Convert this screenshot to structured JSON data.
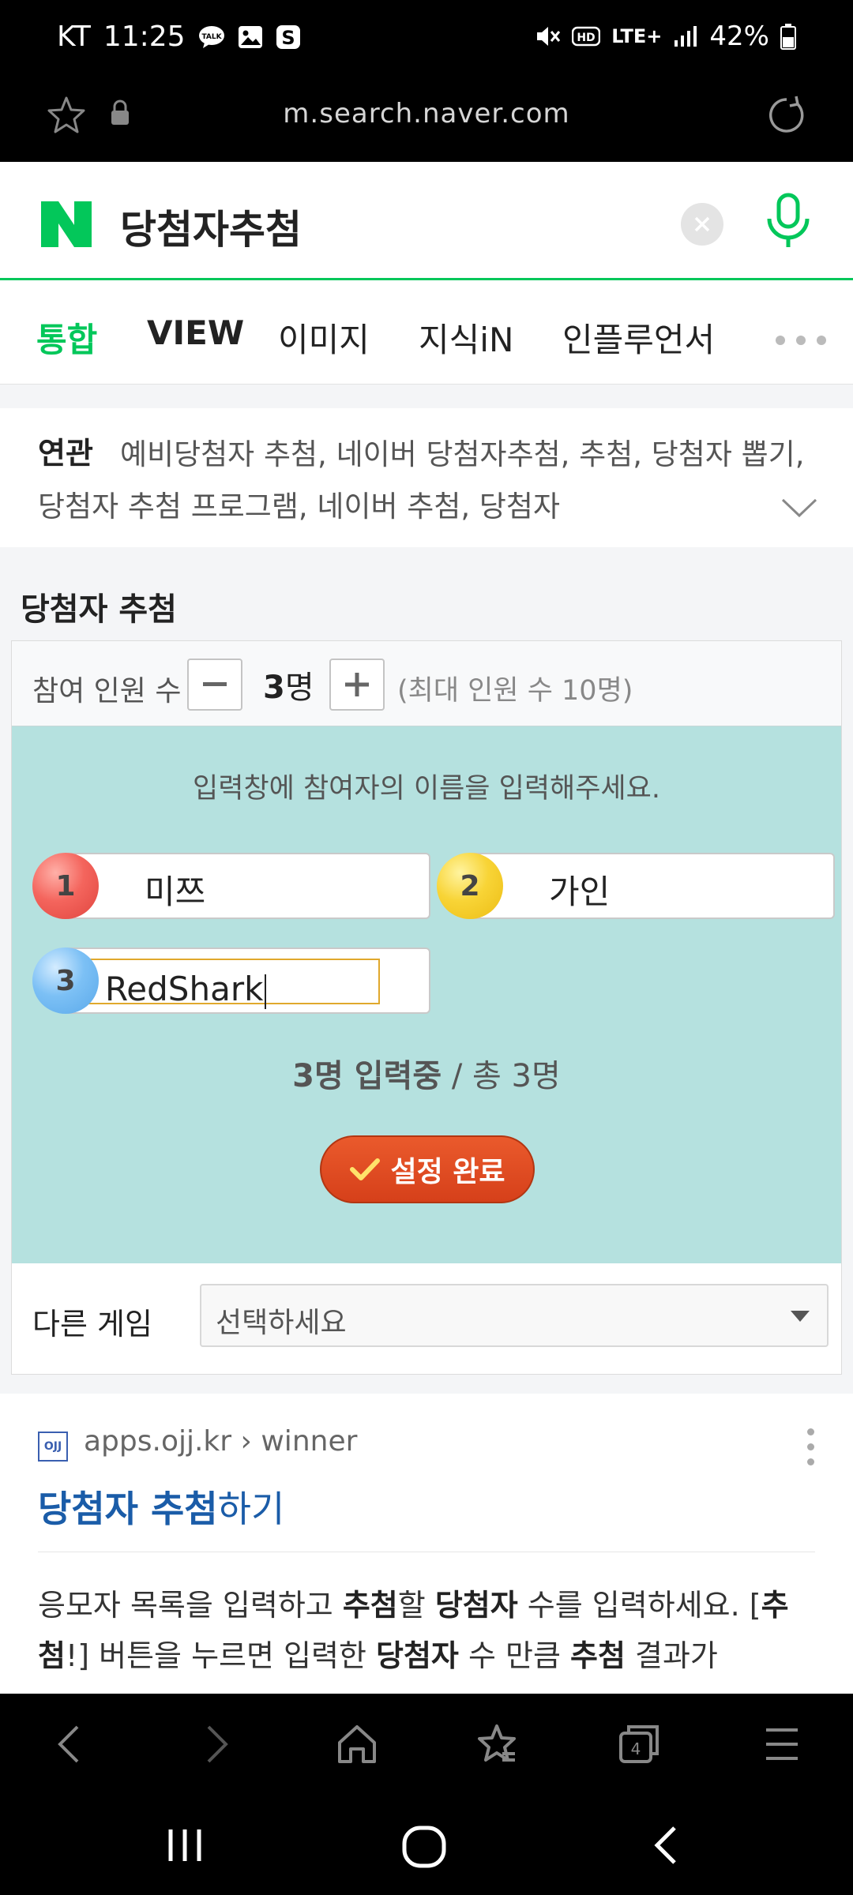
{
  "status_bar": {
    "carrier": "KT",
    "time": "11:25",
    "battery": "42%",
    "network": "LTE+"
  },
  "browser": {
    "url": "m.search.naver.com"
  },
  "search": {
    "query": "당첨자추첨"
  },
  "tabs": [
    {
      "label": "통합",
      "active": true
    },
    {
      "label": "VIEW"
    },
    {
      "label": "이미지"
    },
    {
      "label": "지식iN"
    },
    {
      "label": "인플루언서"
    }
  ],
  "related": {
    "label": "연관",
    "line1": "예비당첨자 추첨, 네이버 당첨자추첨, 추첨, 당첨자 뽑기,",
    "line2": "당첨자 추첨 프로그램, 네이버 추첨, 당첨자"
  },
  "widget": {
    "title": "당첨자 추첨",
    "participants_label": "참여 인원 수",
    "count": "3",
    "count_unit": "명",
    "max_note": "(최대 인원 수 10명)",
    "instruction": "입력창에 참여자의 이름을 입력해주세요.",
    "entries": [
      {
        "number": "1",
        "name": "미쯔",
        "color": "#f4655d"
      },
      {
        "number": "2",
        "name": "가인",
        "color": "#f8d436"
      },
      {
        "number": "3",
        "name": "RedShark",
        "color": "#7cc0f5"
      }
    ],
    "status_bold": "3명 입력중",
    "status_rest": " / 총 3명",
    "done_label": "설정 완료",
    "other_label": "다른 게임",
    "other_select": "선택하세요"
  },
  "result": {
    "site_icon_text": "OJJ",
    "site_url": "apps.ojj.kr › winner",
    "title_bold": "당첨자 추첨",
    "title_rest": "하기",
    "desc_html_parts": [
      {
        "t": "응모자 목록을 입력하고 ",
        "b": false
      },
      {
        "t": "추첨",
        "b": true
      },
      {
        "t": "할 ",
        "b": false
      },
      {
        "t": "당첨자",
        "b": true
      },
      {
        "t": " 수를 입력하세요. [",
        "b": false
      },
      {
        "t": "추첨",
        "b": true
      },
      {
        "t": "!] 버튼을 누르면 입력한 ",
        "b": false
      },
      {
        "t": "당첨자",
        "b": true
      },
      {
        "t": " 수 만큼 ",
        "b": false
      },
      {
        "t": "추첨",
        "b": true
      },
      {
        "t": " 결과가",
        "b": false
      }
    ]
  },
  "colors": {
    "naver_green": "#03c75a",
    "link_blue": "#1a5ca8",
    "widget_bg": "#b5e1df",
    "done_button": "#e0491f"
  }
}
